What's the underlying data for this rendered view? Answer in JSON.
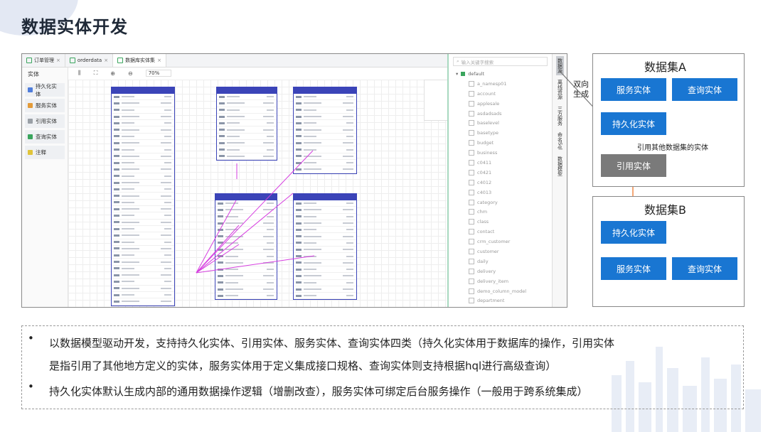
{
  "slide": {
    "title": "数据实体开发"
  },
  "ide": {
    "tabs": [
      {
        "label": "订单管理"
      },
      {
        "label": "orderdata"
      },
      {
        "label": "数据库实体集"
      }
    ],
    "entity_panel": {
      "header": "实体",
      "items": [
        {
          "label": "持久化实体",
          "color": "#4f7ddb"
        },
        {
          "label": "服务实体",
          "color": "#e39b39"
        },
        {
          "label": "引用实体",
          "color": "#9aa0a6"
        },
        {
          "label": "查询实体",
          "color": "#3aa55d"
        },
        {
          "label": "注释",
          "color": "#e0c43a"
        }
      ]
    },
    "toolbar": {
      "zoom": "70%"
    },
    "tree": {
      "search_placeholder": "输入关键字搜索",
      "root": "default",
      "nodes": [
        "a_namesp01",
        "account",
        "applesale",
        "asdadsads",
        "baselevel",
        "basetype",
        "budget",
        "business",
        "c0411",
        "c0421",
        "c4012",
        "c4013",
        "category",
        "chm",
        "class",
        "contact",
        "crm_customer",
        "customer",
        "daily",
        "delivery",
        "delivery_item",
        "demo_column_model",
        "department"
      ]
    },
    "side_tabs": [
      "数据源",
      "离线资源",
      "三方服务",
      "命名Sql",
      "数据模型"
    ]
  },
  "diagram": {
    "ds_a": {
      "title": "数据集A",
      "service": "服务实体",
      "query": "查询实体",
      "persist": "持久化实体",
      "ref": "引用实体"
    },
    "ds_b": {
      "title": "数据集B",
      "persist": "持久化实体",
      "service": "服务实体",
      "query": "查询实体"
    },
    "bidirectional": "双向生成",
    "ref_note": "引用其他数据集的实体"
  },
  "bullets": {
    "b1_line1": "以数据模型驱动开发，支持持久化实体、引用实体、服务实体、查询实体四类（持久化实体用于数据库的操作，引用实体",
    "b1_line2": "是指引用了其他地方定义的实体，服务实体用于定义集成接口规格、查询实体则支持根据hql进行高级查询）",
    "b2": "持久化实体默认生成内部的通用数据操作逻辑（增删改查），服务实体可绑定后台服务操作（一般用于跨系统集成）"
  }
}
